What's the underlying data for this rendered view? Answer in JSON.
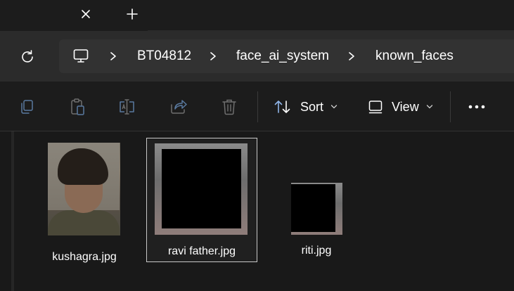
{
  "window": {
    "tab_close_glyph": "✕",
    "tab_new_glyph": "+"
  },
  "address": {
    "breadcrumbs": [
      "BT04812",
      "face_ai_system",
      "known_faces"
    ]
  },
  "toolbar": {
    "sort_label": "Sort",
    "view_label": "View"
  },
  "files": [
    {
      "name": "kushagra.jpg",
      "selected": false
    },
    {
      "name": "ravi father.jpg",
      "selected": true
    },
    {
      "name": "riti.jpg",
      "selected": false
    }
  ],
  "icons": {
    "tab_close": "close-icon",
    "tab_new": "plus-icon",
    "refresh": "refresh-icon",
    "this_pc": "monitor-icon",
    "copy": "copy-icon",
    "paste": "paste-icon",
    "rename": "rename-icon",
    "share": "share-icon",
    "delete": "trash-icon",
    "sort": "sort-icon",
    "view": "view-icon",
    "more": "more-icon"
  },
  "colors": {
    "background": "#1c1c1c",
    "navbar": "#2b2b2b",
    "addressbar": "#323232",
    "content": "#191919",
    "disabled_icon": "#5a7aa0",
    "accent_icon": "#8fb5e8"
  }
}
